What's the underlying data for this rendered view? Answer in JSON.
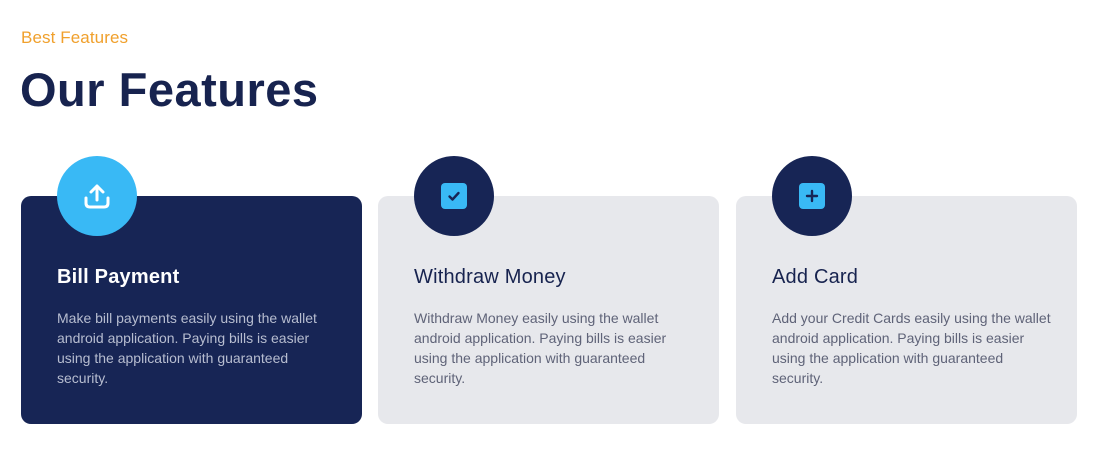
{
  "section": {
    "eyebrow": "Best Features",
    "title": "Our Features"
  },
  "colors": {
    "accent_orange": "#f0a02c",
    "navy": "#172555",
    "cyan": "#39b9f5",
    "light_card": "#e7e8ec"
  },
  "features": [
    {
      "icon": "upload-icon",
      "title": "Bill Payment",
      "description": "Make bill payments easily using the wallet android application. Paying bills is easier using the application with guaranteed security."
    },
    {
      "icon": "checkbox-icon",
      "title": "Withdraw Money",
      "description": "Withdraw Money easily using the wallet android application. Paying bills is easier using the application with guaranteed security."
    },
    {
      "icon": "add-square-icon",
      "title": "Add Card",
      "description": "Add your Credit Cards easily using the wallet android application. Paying bills is easier using the application with guaranteed security."
    }
  ]
}
